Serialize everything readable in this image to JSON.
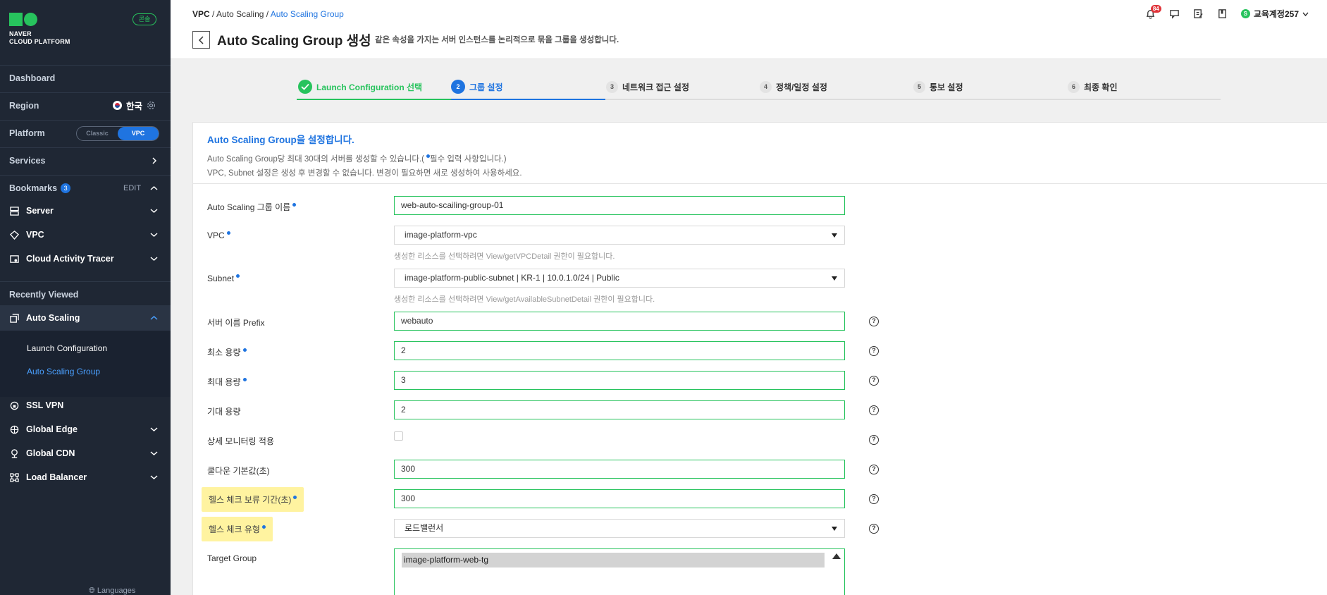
{
  "sidebar": {
    "logo_line1": "NAVER",
    "logo_line2": "CLOUD PLATFORM",
    "console_badge": "콘솔",
    "dashboard": "Dashboard",
    "region_label": "Region",
    "region_value": "한국",
    "platform_label": "Platform",
    "platform_options": [
      "Classic",
      "VPC"
    ],
    "platform_selected": "VPC",
    "services": "Services",
    "bookmarks_label": "Bookmarks",
    "bookmarks_count": "3",
    "bookmarks_edit": "EDIT",
    "bookmarks": [
      {
        "label": "Server",
        "icon": "server-icon"
      },
      {
        "label": "VPC",
        "icon": "vpc-icon"
      },
      {
        "label": "Cloud Activity Tracer",
        "icon": "tracer-icon"
      }
    ],
    "recently_viewed": "Recently Viewed",
    "auto_scaling": "Auto Scaling",
    "auto_scaling_sub": [
      "Launch Configuration",
      "Auto Scaling Group"
    ],
    "recent_items": [
      {
        "label": "SSL VPN",
        "icon": "ssl-vpn-icon"
      },
      {
        "label": "Global Edge",
        "icon": "global-edge-icon"
      },
      {
        "label": "Global CDN",
        "icon": "global-cdn-icon"
      },
      {
        "label": "Load Balancer",
        "icon": "load-balancer-icon"
      }
    ],
    "languages": "Languages"
  },
  "header": {
    "breadcrumb": [
      "VPC",
      "Auto Scaling",
      "Auto Scaling Group"
    ],
    "title": "Auto Scaling Group 생성",
    "description": "같은 속성을 가지는 서버 인스턴스를 논리적으로 묶을 그룹을 생성합니다.",
    "notification_count": "84",
    "user_name": "교육계정257",
    "user_initial": "S"
  },
  "steps": [
    {
      "num": "1",
      "label": "Launch Configuration 선택",
      "state": "done"
    },
    {
      "num": "2",
      "label": "그룹 설정",
      "state": "active"
    },
    {
      "num": "3",
      "label": "네트워크 접근 설정",
      "state": "todo"
    },
    {
      "num": "4",
      "label": "정책/일정 설정",
      "state": "todo"
    },
    {
      "num": "5",
      "label": "통보 설정",
      "state": "todo"
    },
    {
      "num": "6",
      "label": "최종 확인",
      "state": "todo"
    }
  ],
  "intro": {
    "heading": "Auto Scaling Group을 설정합니다.",
    "line1_a": "Auto Scaling Group당 최대 30대의 서버를 생성할 수 있습니다.(",
    "line1_b": "필수 입력 사항입니다.)",
    "line2": "VPC, Subnet 설정은 생성 후 변경할 수 없습니다. 변경이 필요하면 새로 생성하여 사용하세요."
  },
  "form": {
    "group_name_label": "Auto Scaling 그룹 이름",
    "group_name_value": "web-auto-scailing-group-01",
    "vpc_label": "VPC",
    "vpc_value": "image-platform-vpc",
    "vpc_hint": "생성한 리소스를 선택하려면 View/getVPCDetail 권한이 필요합니다.",
    "subnet_label": "Subnet",
    "subnet_value": "image-platform-public-subnet | KR-1 | 10.0.1.0/24 | Public",
    "subnet_hint": "생성한 리소스를 선택하려면 View/getAvailableSubnetDetail 권한이 필요합니다.",
    "prefix_label": "서버 이름 Prefix",
    "prefix_value": "webauto",
    "min_label": "최소 용량",
    "min_value": "2",
    "max_label": "최대 용량",
    "max_value": "3",
    "desired_label": "기대 용량",
    "desired_value": "2",
    "monitoring_label": "상세 모니터링 적용",
    "cooldown_label": "쿨다운 기본값(초)",
    "cooldown_value": "300",
    "grace_label": "헬스 체크 보류 기간(초)",
    "grace_value": "300",
    "hc_type_label": "헬스 체크 유형",
    "hc_type_value": "로드밸런서",
    "target_group_label": "Target Group",
    "target_group_value": "image-platform-web-tg",
    "help_glyph": "?"
  },
  "colors": {
    "accent": "#1f74e0",
    "success": "#27c35d",
    "sidebar_bg": "#1f2734",
    "highlight": "#fff3a0"
  }
}
